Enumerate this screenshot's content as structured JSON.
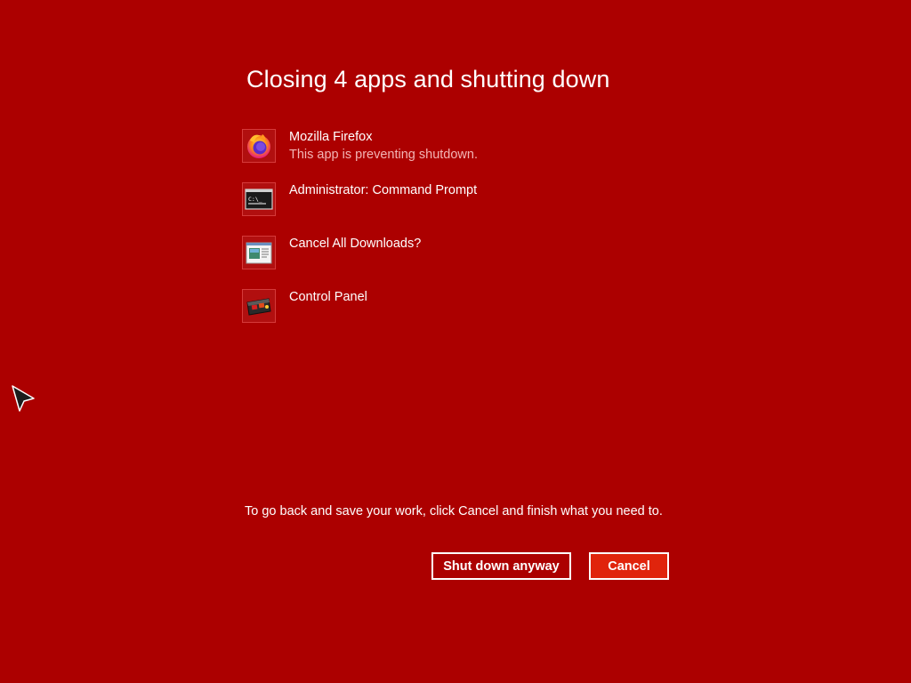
{
  "dialog": {
    "title": "Closing 4 apps and shutting down",
    "message": "To go back and save your work, click Cancel and finish what you need to."
  },
  "apps": [
    {
      "name": "Mozilla Firefox",
      "status": "This app is preventing shutdown.",
      "icon": "firefox-icon"
    },
    {
      "name": "Administrator: Command Prompt",
      "status": "",
      "icon": "command-prompt-icon"
    },
    {
      "name": "Cancel All Downloads?",
      "status": "",
      "icon": "downloads-window-icon"
    },
    {
      "name": "Control Panel",
      "status": "",
      "icon": "control-panel-icon"
    }
  ],
  "buttons": {
    "shutdown_label": "Shut down anyway",
    "cancel_label": "Cancel"
  },
  "colors": {
    "background": "#ac0000",
    "cancel_button": "#e0240c",
    "status_text": "#f2b5b5"
  }
}
